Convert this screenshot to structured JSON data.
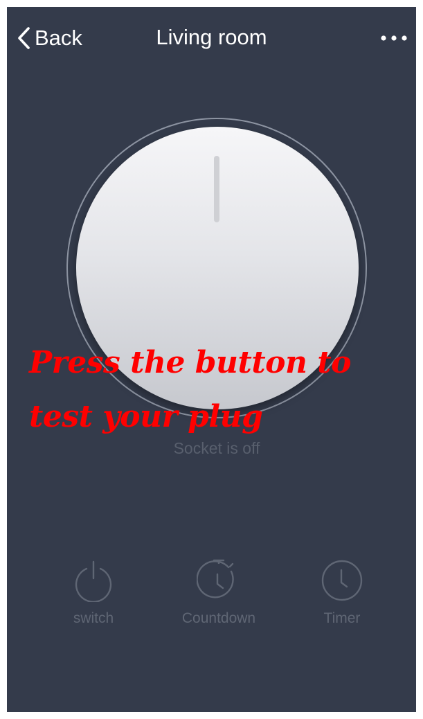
{
  "nav": {
    "back_label": "Back",
    "title": "Living room",
    "more_icon": "more-dots-icon"
  },
  "device": {
    "status": "Socket is off",
    "power_icon": "power-dial"
  },
  "overlay": {
    "line1": "Press the button to",
    "line2": "test your plug",
    "color": "#ff0000"
  },
  "actions": [
    {
      "label": "switch",
      "icon": "power-icon"
    },
    {
      "label": "Countdown",
      "icon": "stopwatch-icon"
    },
    {
      "label": "Timer",
      "icon": "clock-icon"
    }
  ],
  "colors": {
    "background": "#343b4b",
    "header_text": "#ffffff",
    "muted_text": "#5f6674"
  }
}
